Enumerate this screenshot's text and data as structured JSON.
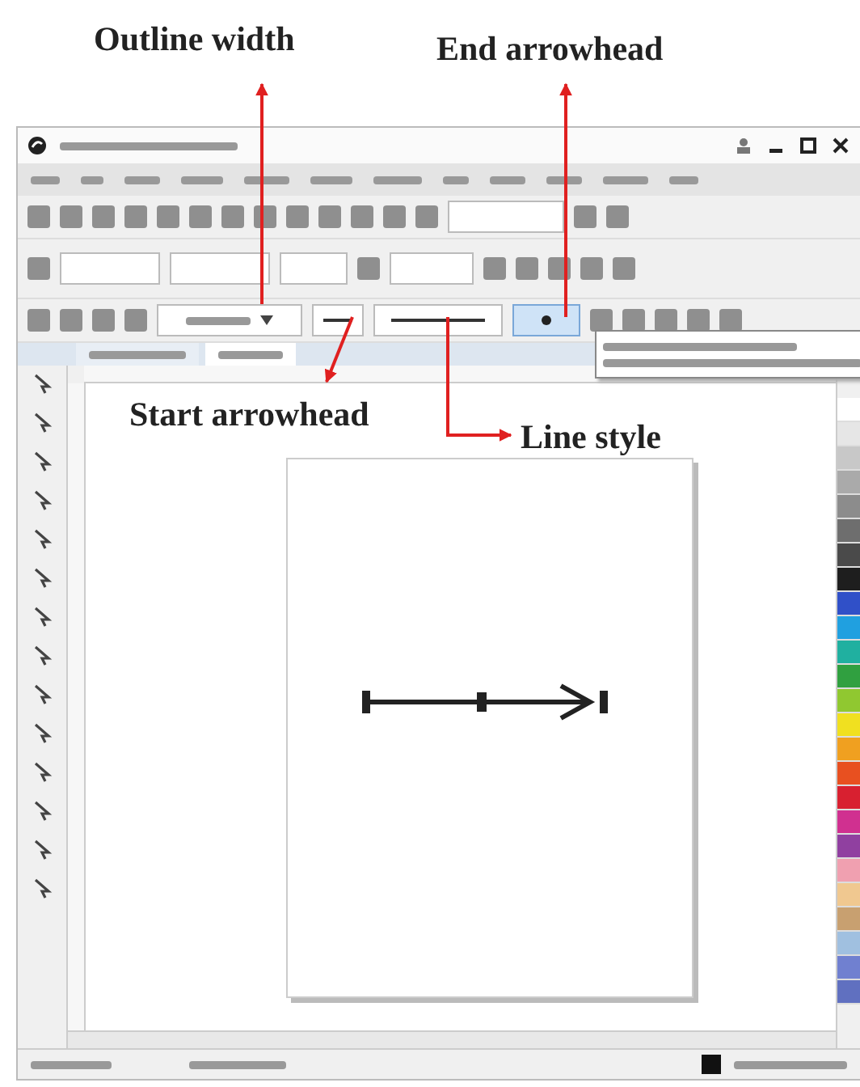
{
  "annotations": [
    {
      "label": "Outline width"
    },
    {
      "label": "End arrowhead"
    },
    {
      "label": "Start arrowhead"
    },
    {
      "label": "Line style"
    }
  ],
  "palette": [
    {
      "color": "#ffffff"
    },
    {
      "color": "#e6e6e6"
    },
    {
      "color": "#c8c8c8"
    },
    {
      "color": "#aaaaaa"
    },
    {
      "color": "#8c8c8c"
    },
    {
      "color": "#6e6e6e"
    },
    {
      "color": "#4a4a4a"
    },
    {
      "color": "#1e1e1e"
    },
    {
      "color": "#3050c8"
    },
    {
      "color": "#20a0e0"
    },
    {
      "color": "#20b0a0"
    },
    {
      "color": "#30a040"
    },
    {
      "color": "#90c830"
    },
    {
      "color": "#f0e020"
    },
    {
      "color": "#f0a020"
    },
    {
      "color": "#e85020"
    },
    {
      "color": "#d82030"
    },
    {
      "color": "#d03090"
    },
    {
      "color": "#9040a0"
    },
    {
      "color": "#f0a0b0"
    },
    {
      "color": "#f0c890"
    },
    {
      "color": "#c8a070"
    },
    {
      "color": "#a0c0e0"
    },
    {
      "color": "#7080d0"
    },
    {
      "color": "#6070c0"
    }
  ]
}
